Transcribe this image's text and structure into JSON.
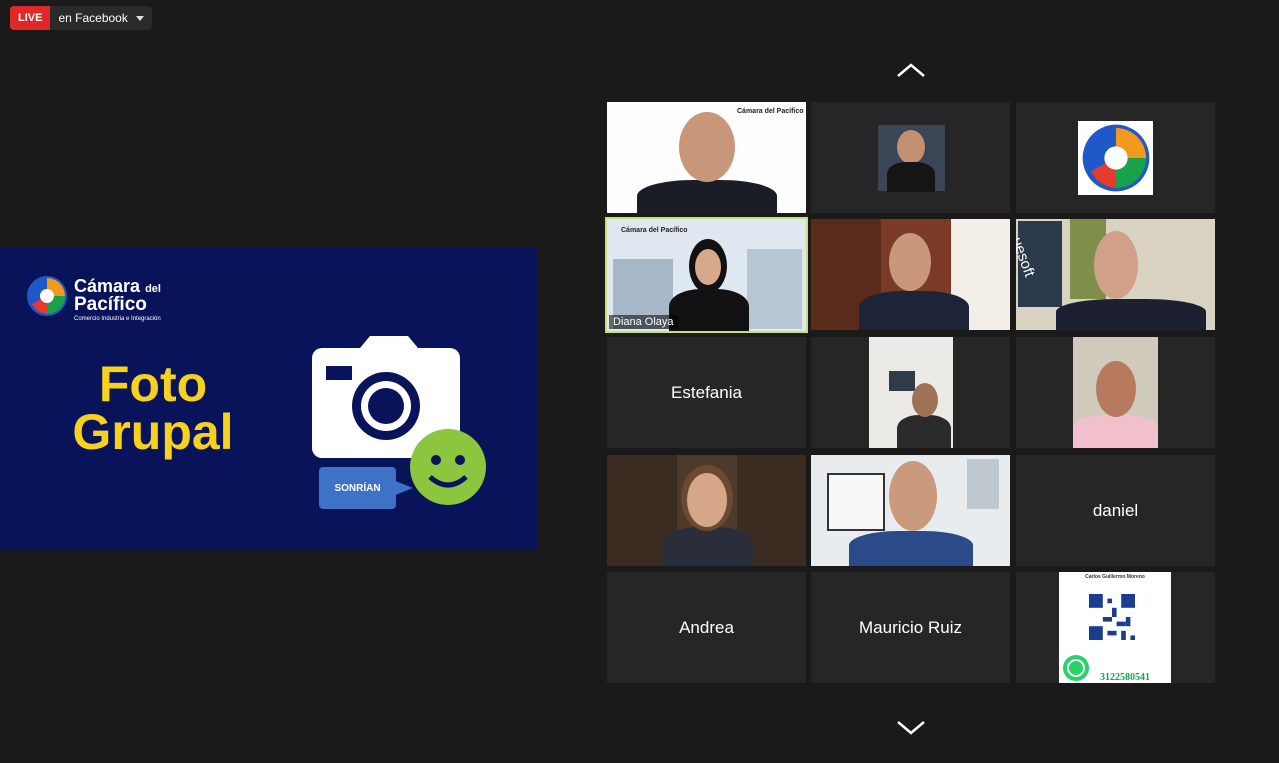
{
  "live": {
    "badge": "LIVE",
    "destination": "en Facebook"
  },
  "shared_screen": {
    "brand_name": "Cámara",
    "brand_suffix": "del",
    "brand_name_2": "Pacífico",
    "brand_tagline": "Comercio Industria e Integración",
    "title_line1": "Foto",
    "title_line2": "Grupal",
    "bubble_text": "SONRÍAN",
    "colors": {
      "background": "#08135a",
      "title": "#f7d21c",
      "smiley": "#8cc63f",
      "bubble": "#3d72c6"
    }
  },
  "gallery": {
    "participants": [
      {
        "name": "",
        "type": "video"
      },
      {
        "name": "",
        "type": "video"
      },
      {
        "name": "",
        "type": "logo"
      },
      {
        "name": "Diana Olaya",
        "type": "video",
        "active_speaker": true
      },
      {
        "name": "",
        "type": "video"
      },
      {
        "name": "",
        "type": "video"
      },
      {
        "name": "Estefania",
        "type": "name_only"
      },
      {
        "name": "",
        "type": "video"
      },
      {
        "name": "",
        "type": "video"
      },
      {
        "name": "",
        "type": "video"
      },
      {
        "name": "",
        "type": "video"
      },
      {
        "name": "daniel",
        "type": "name_only"
      },
      {
        "name": "Andrea",
        "type": "name_only"
      },
      {
        "name": "Mauricio Ruiz",
        "type": "name_only"
      },
      {
        "name": "",
        "type": "image"
      }
    ],
    "badge_logo_text": "Cámara del Pacífico",
    "card_name": "Carlos Guillermo Moreno",
    "card_phone": "3122580541",
    "wall_text": "uesoft",
    "nav": {
      "up_icon": "chevron-up-icon",
      "down_icon": "chevron-down-icon"
    }
  }
}
